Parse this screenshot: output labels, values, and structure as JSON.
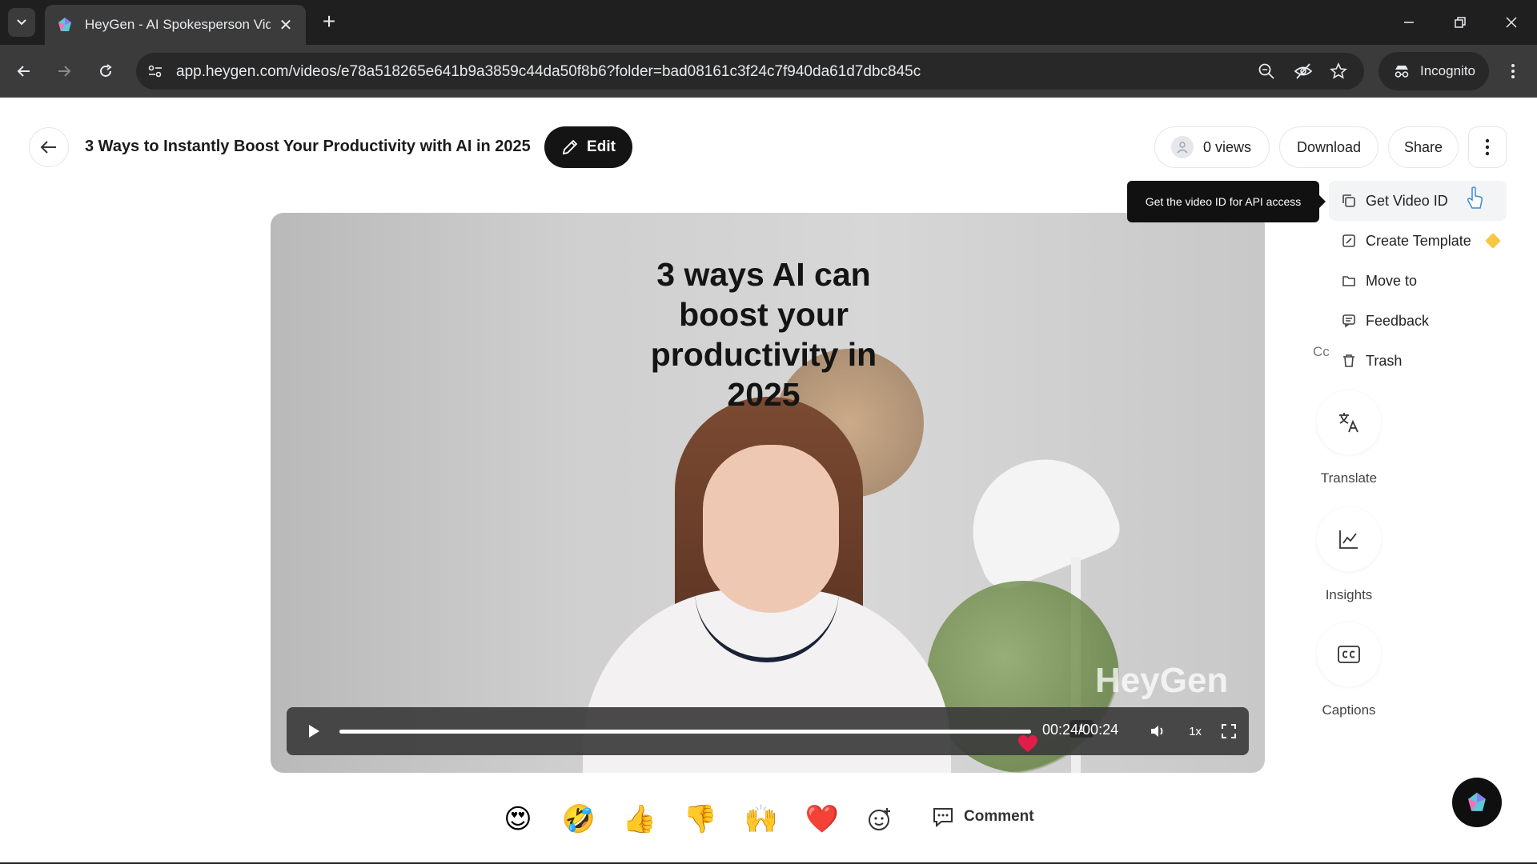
{
  "browser": {
    "tab_title": "HeyGen - AI Spokesperson Vid",
    "url": "app.heygen.com/videos/e78a518265e641b9a3859c44da50f8b6?folder=bad08161c3f24c7f940da61d7dbc845c",
    "incognito_label": "Incognito"
  },
  "header": {
    "title": "3 Ways to Instantly Boost Your Productivity with AI in 2025",
    "edit_label": "Edit",
    "views_label": "0 views",
    "download_label": "Download",
    "share_label": "Share"
  },
  "video": {
    "caption_lines": [
      "3 ways AI can",
      "boost your",
      "productivity in",
      "2025"
    ],
    "watermark": "HeyGen",
    "time": "00:24/00:24",
    "speed": "1x",
    "marker_count": "1",
    "progress": 1.0,
    "heart_color": "#e11d48"
  },
  "tooltip": {
    "text": "Get the video ID for API access"
  },
  "menu": {
    "items": [
      {
        "label": "Get Video ID",
        "icon": "copy-icon"
      },
      {
        "label": "Create Template",
        "icon": "template-icon"
      },
      {
        "label": "Move to",
        "icon": "folder-icon"
      },
      {
        "label": "Feedback",
        "icon": "feedback-icon"
      },
      {
        "label": "Trash",
        "icon": "trash-icon"
      }
    ]
  },
  "sidebar": {
    "clipped_text": "Cc",
    "tools": [
      {
        "label": "Translate",
        "icon": "translate-icon"
      },
      {
        "label": "Insights",
        "icon": "insights-icon"
      },
      {
        "label": "Captions",
        "icon": "captions-icon"
      }
    ]
  },
  "reactions": {
    "items": [
      "😍",
      "🤣",
      "👍",
      "👎",
      "🙌",
      "❤️"
    ],
    "comment_label": "Comment"
  },
  "colors": {
    "accent_dark": "#141414",
    "premium_gem": "#f7c744"
  }
}
